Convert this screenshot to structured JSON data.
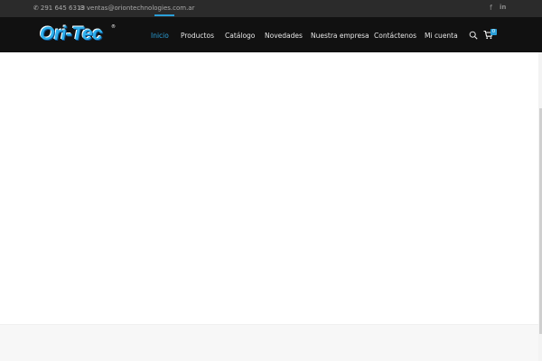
{
  "topbar": {
    "phone": "291 645 6313",
    "email": "ventas@oriontechnologies.com.ar",
    "social": [
      {
        "icon": "facebook-icon",
        "glyph": "f"
      },
      {
        "icon": "linkedin-icon",
        "glyph": "in"
      }
    ]
  },
  "header": {
    "logo_text": "Ori-Tec",
    "logo_mark": "®"
  },
  "nav": {
    "items": [
      {
        "label": "Inicio",
        "active": true
      },
      {
        "label": "Productos",
        "active": false
      },
      {
        "label": "Catálogo",
        "active": false
      },
      {
        "label": "Novedades",
        "active": false
      },
      {
        "label": "Nuestra empresa",
        "active": false
      },
      {
        "label": "Contáctenos",
        "active": false
      },
      {
        "label": "Mi cuenta",
        "active": false
      }
    ],
    "cart_count": "0"
  },
  "colors": {
    "accent": "#2a9fd8",
    "topbar_bg": "#2b2b2b",
    "nav_bg": "#111111"
  }
}
